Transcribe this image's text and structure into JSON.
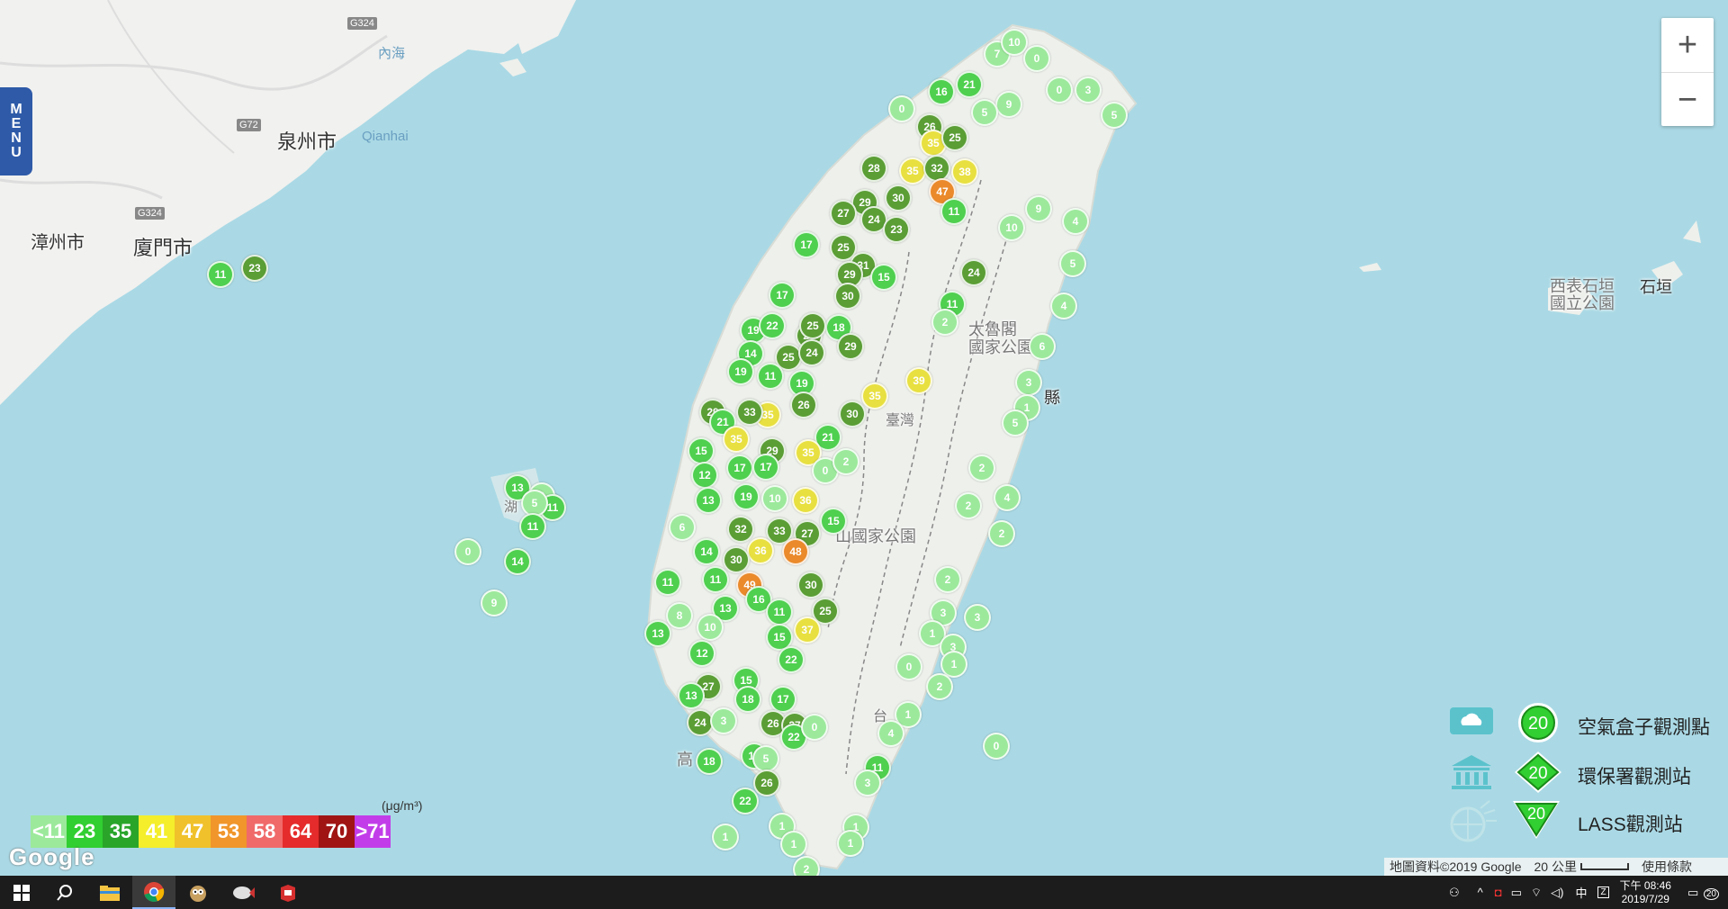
{
  "app": {
    "menu_label": "MENU"
  },
  "map": {
    "labels": {
      "quanzhou": "泉州市",
      "qianhai": "Qianhai",
      "zhangzhou": "漳州市",
      "xiamen": "廈門市",
      "shigaki": "石垣",
      "ishigaki_park": "西表石垣\n國立公園",
      "taroko": "太魯閣\n國家公園",
      "taiwan": "臺灣",
      "yushan": "山國家公園",
      "taitung_partial": "台",
      "kaohsiung_partial": "高",
      "hualien_partial": "縣",
      "penghu_partial": "湖",
      "neihai": "內海",
      "road_g324_top": "G324",
      "road_g72": "G72",
      "road_g324_mid": "G324"
    },
    "zoom": {
      "in": "+",
      "out": "−"
    },
    "google_logo": "Google",
    "attribution": {
      "data": "地圖資料©2019 Google",
      "scale": "20 公里",
      "terms": "使用條款"
    }
  },
  "pm_scale": {
    "unit": "(μg/m³)",
    "items": [
      {
        "label": "<11",
        "color": "#9ce99c"
      },
      {
        "label": "23",
        "color": "#31cf31"
      },
      {
        "label": "35",
        "color": "#2aa52a"
      },
      {
        "label": "41",
        "color": "#f4ee2b"
      },
      {
        "label": "47",
        "color": "#f0c12b"
      },
      {
        "label": "53",
        "color": "#f0962b"
      },
      {
        "label": "58",
        "color": "#f06a6a"
      },
      {
        "label": "64",
        "color": "#e52b2b"
      },
      {
        "label": "70",
        "color": "#a01414"
      },
      {
        "label": ">71",
        "color": "#c23de9"
      }
    ]
  },
  "legend": {
    "airbox": {
      "label": "空氣盒子觀測點",
      "value": "20"
    },
    "epa": {
      "label": "環保署觀測站",
      "value": "20"
    },
    "lass": {
      "label": "LASS觀測站",
      "value": "20"
    }
  },
  "markers": [
    [
      "21",
      1077,
      94
    ],
    [
      "16",
      1046,
      102
    ],
    [
      "7",
      1108,
      60
    ],
    [
      "10",
      1127,
      47
    ],
    [
      "0",
      1152,
      65
    ],
    [
      "0",
      1177,
      100
    ],
    [
      "3",
      1209,
      100
    ],
    [
      "5",
      1238,
      128
    ],
    [
      "9",
      1121,
      116
    ],
    [
      "5",
      1094,
      125
    ],
    [
      "0",
      1002,
      121
    ],
    [
      "26",
      1033,
      141
    ],
    [
      "35",
      1037,
      159
    ],
    [
      "25",
      1061,
      153
    ],
    [
      "28",
      971,
      187
    ],
    [
      "35",
      1014,
      190
    ],
    [
      "38",
      1072,
      191
    ],
    [
      "32",
      1041,
      187
    ],
    [
      "47",
      1047,
      213
    ],
    [
      "30",
      998,
      220
    ],
    [
      "29",
      961,
      225
    ],
    [
      "27",
      937,
      237
    ],
    [
      "24",
      971,
      244
    ],
    [
      "23",
      996,
      255
    ],
    [
      "11",
      1060,
      235
    ],
    [
      "17",
      896,
      272
    ],
    [
      "25",
      937,
      275
    ],
    [
      "31",
      959,
      295
    ],
    [
      "29",
      944,
      305
    ],
    [
      "15",
      982,
      308
    ],
    [
      "10",
      1124,
      253
    ],
    [
      "9",
      1154,
      232
    ],
    [
      "24",
      1082,
      303
    ],
    [
      "4",
      1195,
      246
    ],
    [
      "5",
      1192,
      293
    ],
    [
      "4",
      1182,
      340
    ],
    [
      "17",
      869,
      328
    ],
    [
      "30",
      942,
      329
    ],
    [
      "18",
      932,
      364
    ],
    [
      "28",
      899,
      373
    ],
    [
      "25",
      903,
      362
    ],
    [
      "19",
      837,
      367
    ],
    [
      "22",
      858,
      362
    ],
    [
      "25",
      876,
      397
    ],
    [
      "24",
      902,
      392
    ],
    [
      "29",
      945,
      385
    ],
    [
      "11",
      1058,
      338
    ],
    [
      "2",
      1050,
      358
    ],
    [
      "6",
      1158,
      385
    ],
    [
      "14",
      834,
      393
    ],
    [
      "19",
      823,
      413
    ],
    [
      "11",
      856,
      418
    ],
    [
      "19",
      891,
      426
    ],
    [
      "35",
      972,
      440
    ],
    [
      "39",
      1021,
      423
    ],
    [
      "3",
      1143,
      425
    ],
    [
      "1",
      1141,
      453
    ],
    [
      "5",
      1128,
      470
    ],
    [
      "29",
      792,
      458
    ],
    [
      "21",
      803,
      469
    ],
    [
      "35",
      853,
      461
    ],
    [
      "33",
      833,
      458
    ],
    [
      "26",
      893,
      450
    ],
    [
      "30",
      947,
      460
    ],
    [
      "35",
      818,
      488
    ],
    [
      "21",
      920,
      486
    ],
    [
      "15",
      779,
      501
    ],
    [
      "29",
      858,
      501
    ],
    [
      "35",
      898,
      503
    ],
    [
      "0",
      917,
      523
    ],
    [
      "2",
      940,
      513
    ],
    [
      "12",
      783,
      528
    ],
    [
      "17",
      822,
      520
    ],
    [
      "17",
      851,
      519
    ],
    [
      "2",
      1091,
      520
    ],
    [
      "36",
      895,
      556
    ],
    [
      "19",
      829,
      552
    ],
    [
      "10",
      861,
      554
    ],
    [
      "13",
      787,
      556
    ],
    [
      "6",
      758,
      586
    ],
    [
      "4",
      1119,
      553
    ],
    [
      "15",
      926,
      579
    ],
    [
      "2",
      1076,
      562
    ],
    [
      "32",
      823,
      588
    ],
    [
      "27",
      897,
      593
    ],
    [
      "33",
      866,
      590
    ],
    [
      "48",
      884,
      613
    ],
    [
      "36",
      845,
      612
    ],
    [
      "14",
      785,
      613
    ],
    [
      "30",
      818,
      622
    ],
    [
      "2",
      1113,
      593
    ],
    [
      "11",
      742,
      647
    ],
    [
      "49",
      833,
      650
    ],
    [
      "30",
      901,
      650
    ],
    [
      "11",
      795,
      644
    ],
    [
      "16",
      843,
      666
    ],
    [
      "2",
      1053,
      644
    ],
    [
      "25",
      917,
      679
    ],
    [
      "11",
      866,
      680
    ],
    [
      "13",
      806,
      676
    ],
    [
      "8",
      755,
      684
    ],
    [
      "10",
      789,
      697
    ],
    [
      "37",
      897,
      700
    ],
    [
      "15",
      866,
      708
    ],
    [
      "3",
      1086,
      686
    ],
    [
      "3",
      1048,
      681
    ],
    [
      "13",
      731,
      704
    ],
    [
      "12",
      780,
      726
    ],
    [
      "22",
      879,
      733
    ],
    [
      "1",
      1036,
      704
    ],
    [
      "3",
      1059,
      719
    ],
    [
      "15",
      829,
      756
    ],
    [
      "17",
      870,
      777
    ],
    [
      "18",
      831,
      777
    ],
    [
      "1",
      1060,
      738
    ],
    [
      "0",
      1010,
      741
    ],
    [
      "27",
      787,
      763
    ],
    [
      "13",
      768,
      773
    ],
    [
      "24",
      778,
      803
    ],
    [
      "3",
      804,
      801
    ],
    [
      "26",
      859,
      804
    ],
    [
      "2",
      1044,
      763
    ],
    [
      "27",
      883,
      806
    ],
    [
      "22",
      882,
      819
    ],
    [
      "1",
      1009,
      794
    ],
    [
      "4",
      990,
      815
    ],
    [
      "0",
      905,
      808
    ],
    [
      "0",
      1107,
      829
    ],
    [
      "18",
      788,
      846
    ],
    [
      "16",
      838,
      840
    ],
    [
      "5",
      851,
      843
    ],
    [
      "22",
      828,
      890
    ],
    [
      "26",
      852,
      870
    ],
    [
      "11",
      975,
      853
    ],
    [
      "3",
      964,
      870
    ],
    [
      "1",
      869,
      918
    ],
    [
      "1",
      882,
      938
    ],
    [
      "1",
      806,
      930
    ],
    [
      "1",
      951,
      919
    ],
    [
      "1",
      945,
      937
    ],
    [
      "2",
      896,
      966
    ],
    [
      "11",
      612,
      563
    ],
    [
      "13",
      575,
      542
    ],
    [
      "6",
      602,
      551
    ],
    [
      "11",
      614,
      564
    ],
    [
      "5",
      594,
      559
    ],
    [
      "11",
      592,
      585
    ],
    [
      "0",
      520,
      613
    ],
    [
      "14",
      575,
      624
    ],
    [
      "9",
      549,
      670
    ],
    [
      "23",
      283,
      298
    ],
    [
      "11",
      245,
      305
    ]
  ],
  "taskbar": {
    "clock_time": "下午 08:46",
    "clock_date": "2019/7/29",
    "ime": "中",
    "notification_count": "20"
  }
}
